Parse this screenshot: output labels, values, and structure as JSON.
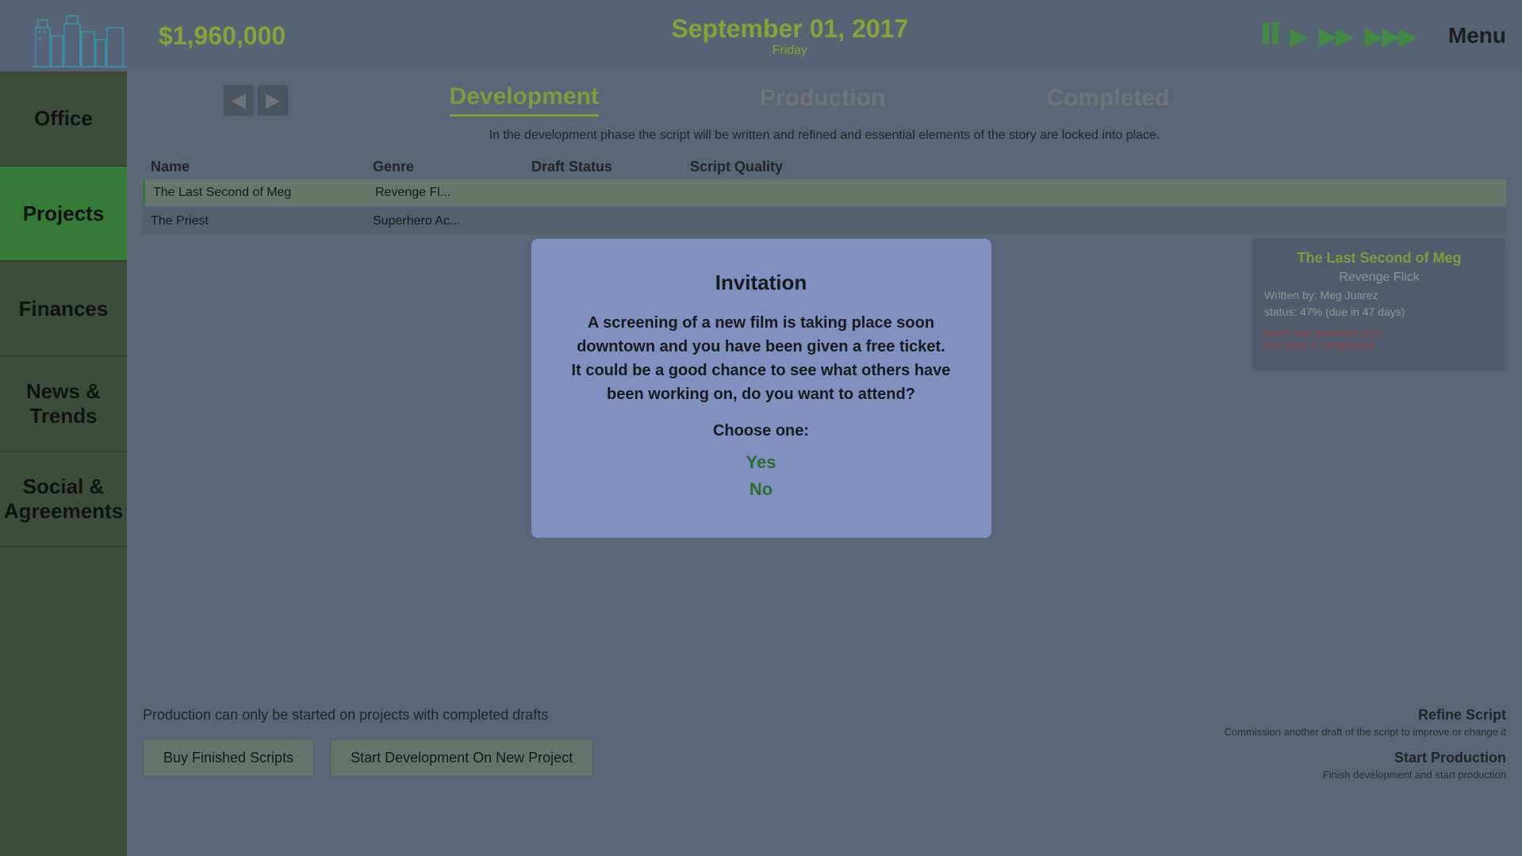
{
  "topbar": {
    "money": "$1,960,000",
    "date_main": "September 01, 2017",
    "date_day": "Friday",
    "menu_label": "Menu"
  },
  "controls": {
    "pause_label": "⏸",
    "play_label": "▶",
    "fast_label": "▶▶",
    "fastest_label": "▶▶▶"
  },
  "sidebar": {
    "items": [
      {
        "id": "office",
        "label": "Office",
        "active": false
      },
      {
        "id": "projects",
        "label": "Projects",
        "active": true
      },
      {
        "id": "finances",
        "label": "Finances",
        "active": false
      },
      {
        "id": "news-trends",
        "label": "News & Trends",
        "active": false
      },
      {
        "id": "social-agreements",
        "label": "Social & Agreements",
        "active": false
      }
    ]
  },
  "tabs": {
    "development": {
      "label": "Development",
      "active": true
    },
    "production": {
      "label": "Production",
      "active": false
    },
    "completed": {
      "label": "Completed",
      "active": false
    }
  },
  "phase_description": "In the development phase the script will be written and refined and essential elements of the story are locked into place.",
  "table": {
    "headers": [
      "Name",
      "Genre",
      "Draft Status",
      "Script Quality",
      ""
    ],
    "rows": [
      {
        "name": "The Last Second of Meg",
        "genre": "Revenge Fl...",
        "draft_status": "",
        "script_quality": "",
        "selected": true
      },
      {
        "name": "The Priest",
        "genre": "Superhero Ac...",
        "draft_status": "",
        "script_quality": "",
        "selected": false
      }
    ]
  },
  "right_panel": {
    "title": "The Last Second of Meg",
    "genre": "Revenge Flick",
    "writer": "Written by: Meg Juarez",
    "status": "status: 47% (due in 47 days)",
    "draft_notice_line1": "drafts not available until",
    "draft_notice_line2": "first draft is completed"
  },
  "bottom": {
    "production_notice": "Production can only be started on projects with completed drafts",
    "buy_scripts_label": "Buy Finished Scripts",
    "start_development_label": "Start Development On New Project"
  },
  "right_actions": {
    "refine_title": "Refine Script",
    "refine_desc": "Commission another draft of the script to improve or change it",
    "start_production_title": "Start Production",
    "start_production_desc": "Finish development and start production"
  },
  "modal": {
    "title": "Invitation",
    "body": "A screening of a new film is taking place soon downtown and you have been given a free ticket.  It could be a good chance to see what others have been working on, do you want to attend?",
    "choose_label": "Choose one:",
    "option_yes": "Yes",
    "option_no": "No"
  }
}
